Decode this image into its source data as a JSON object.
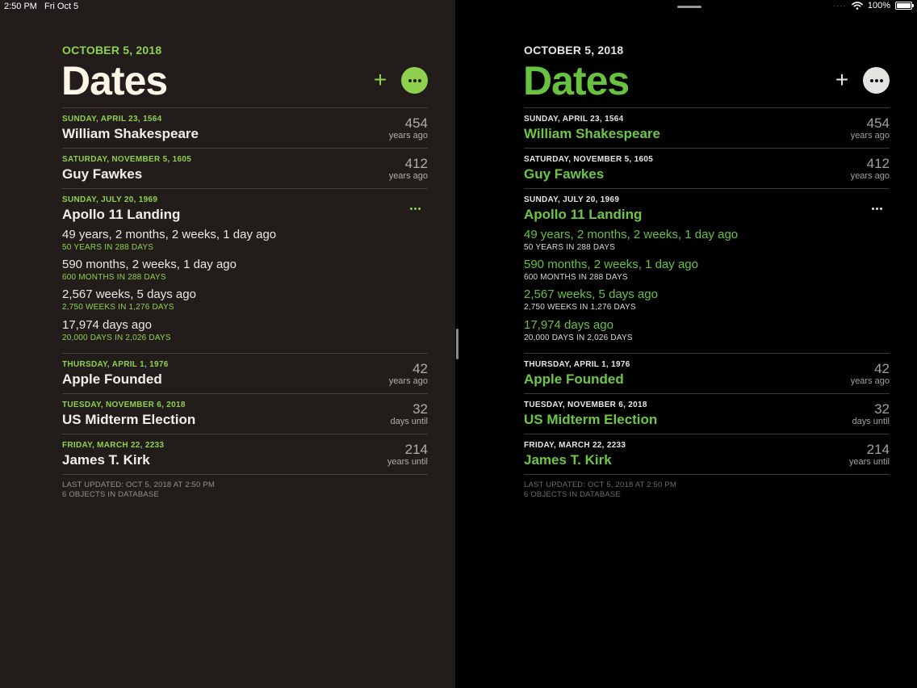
{
  "status": {
    "time": "2:50 PM",
    "date": "Fri Oct 5",
    "battery": "100%"
  },
  "header": {
    "date": "OCTOBER 5, 2018",
    "title": "Dates",
    "add_label": "+"
  },
  "rows": [
    {
      "date": "SUNDAY, APRIL 23, 1564",
      "title": "William Shakespeare",
      "count": "454",
      "unit": "years ago"
    },
    {
      "date": "SATURDAY, NOVEMBER 5, 1605",
      "title": "Guy Fawkes",
      "count": "412",
      "unit": "years ago"
    },
    {
      "date": "SUNDAY, JULY 20, 1969",
      "title": "Apollo 11 Landing",
      "details": [
        {
          "main": "49 years, 2 months, 2 weeks, 1 day ago",
          "sub": "50 YEARS IN 288 DAYS"
        },
        {
          "main": "590 months, 2 weeks, 1 day ago",
          "sub": "600 MONTHS IN 288 DAYS"
        },
        {
          "main": "2,567 weeks, 5 days ago",
          "sub": "2,750 WEEKS IN 1,276 DAYS"
        },
        {
          "main": "17,974 days ago",
          "sub": "20,000 DAYS IN 2,026 DAYS"
        }
      ]
    },
    {
      "date": "THURSDAY, APRIL 1, 1976",
      "title": "Apple Founded",
      "count": "42",
      "unit": "years ago"
    },
    {
      "date": "TUESDAY, NOVEMBER 6, 2018",
      "title": "US Midterm Election",
      "count": "32",
      "unit": "days until"
    },
    {
      "date": "FRIDAY, MARCH 22, 2233",
      "title": "James T. Kirk",
      "count": "214",
      "unit": "years until"
    }
  ],
  "footer": {
    "updated": "LAST UPDATED: OCT 5, 2018 AT 2:50 PM",
    "objects": "6 OBJECTS IN DATABASE"
  },
  "colors": {
    "left_background": "#221d1a",
    "right_background": "#000000",
    "accent_green": "#8fd14e",
    "title_green": "#67c23f"
  },
  "icons": [
    "plus-icon",
    "ellipsis-icon",
    "wifi-icon",
    "battery-icon"
  ]
}
